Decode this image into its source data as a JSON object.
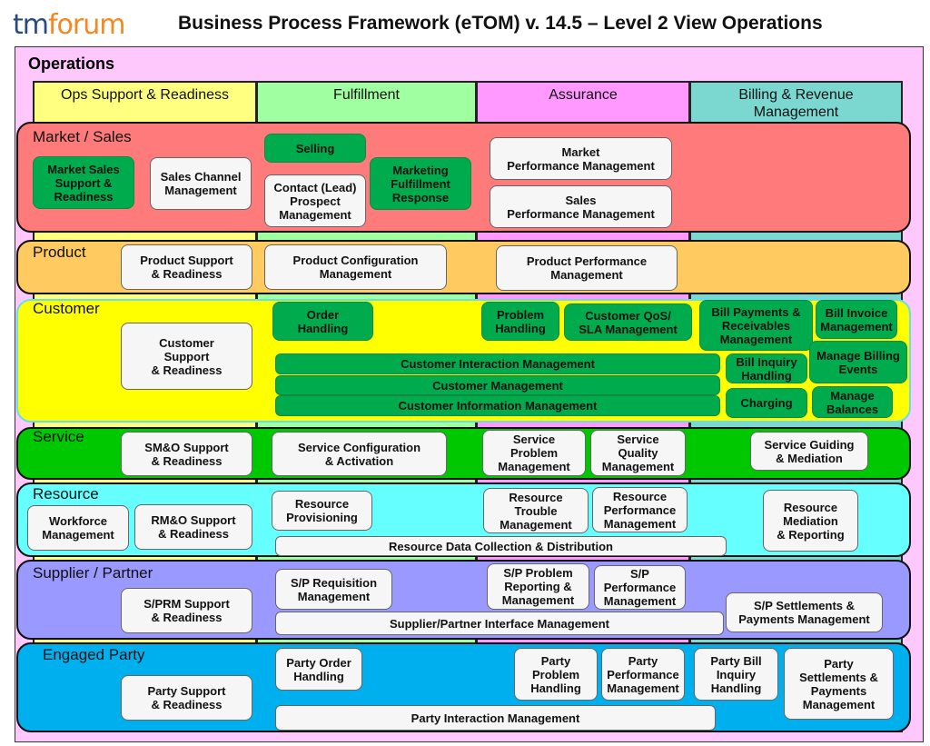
{
  "header": {
    "logo_tm": "tm",
    "logo_forum": "forum",
    "title": "Business Process Framework (eTOM) v. 14.5 – Level 2 View Operations"
  },
  "area": {
    "label": "Operations"
  },
  "columns": [
    {
      "label": "Ops Support & Readiness",
      "color": "#ffff80"
    },
    {
      "label": "Fulfillment",
      "color": "#a0ffa0"
    },
    {
      "label": "Assurance",
      "color": "#ff99ff"
    },
    {
      "label": "Billing & Revenue\nManagement",
      "color": "#7ad8d0"
    }
  ],
  "lanes": {
    "market_sales": {
      "label": "Market / Sales",
      "color": "#ff7b7b"
    },
    "product": {
      "label": "Product",
      "color": "#ffca60"
    },
    "customer": {
      "label": "Customer",
      "color": "#ffff00"
    },
    "service": {
      "label": "Service",
      "color": "#00c800"
    },
    "resource": {
      "label": "Resource",
      "color": "#66ffff"
    },
    "supplier": {
      "label": "Supplier / Partner",
      "color": "#9999ff"
    },
    "party": {
      "label": "Engaged Party",
      "color": "#00b0ee"
    }
  },
  "processes": {
    "market_sales_support": "Market Sales\nSupport &\nReadiness",
    "sales_channel": "Sales Channel\nManagement",
    "selling": "Selling",
    "contact_lead": "Contact (Lead)\nProspect\nManagement",
    "marketing_fulfillment": "Marketing\nFulfillment\nResponse",
    "market_perf": "Market\nPerformance Management",
    "sales_perf": "Sales\nPerformance Management",
    "product_support": "Product Support\n& Readiness",
    "product_config": "Product Configuration\nManagement",
    "product_perf": "Product Performance\nManagement",
    "customer_support": "Customer\nSupport\n& Readiness",
    "order_handling": "Order\nHandling",
    "problem_handling": "Problem\nHandling",
    "customer_qos": "Customer QoS/\nSLA Management",
    "bill_payments": "Bill Payments &\nReceivables\nManagement",
    "bill_invoice": "Bill Invoice\nManagement",
    "customer_interaction": "Customer Interaction Management",
    "customer_mgmt": "Customer Management",
    "customer_info": "Customer Information Management",
    "bill_inquiry": "Bill Inquiry\nHandling",
    "manage_billing_events": "Manage Billing\nEvents",
    "charging": "Charging",
    "manage_balances": "Manage\nBalances",
    "smo_support": "SM&O Support\n& Readiness",
    "service_config": "Service Configuration\n& Activation",
    "service_problem": "Service\nProblem\nManagement",
    "service_quality": "Service\nQuality\nManagement",
    "service_guiding": "Service Guiding\n& Mediation",
    "workforce": "Workforce\nManagement",
    "rmo_support": "RM&O Support\n& Readiness",
    "resource_provisioning": "Resource\nProvisioning",
    "resource_trouble": "Resource\nTrouble\nManagement",
    "resource_perf": "Resource\nPerformance\nManagement",
    "resource_mediation": "Resource\nMediation\n& Reporting",
    "resource_data": "Resource Data Collection & Distribution",
    "sprm_support": "S/PRM Support\n& Readiness",
    "sp_requisition": "S/P Requisition\nManagement",
    "sp_problem": "S/P Problem\nReporting &\nManagement",
    "sp_perf": "S/P\nPerformance\nManagement",
    "sp_interface": "Supplier/Partner Interface Management",
    "sp_settlements": "S/P Settlements &\nPayments Management",
    "party_support": "Party Support\n& Readiness",
    "party_order": "Party Order\nHandling",
    "party_problem": "Party\nProblem\nHandling",
    "party_perf": "Party\nPerformance\nManagement",
    "party_bill_inquiry": "Party Bill\nInquiry\nHandling",
    "party_settlements": "Party\nSettlements &\nPayments\nManagement",
    "party_interaction": "Party Interaction Management"
  }
}
